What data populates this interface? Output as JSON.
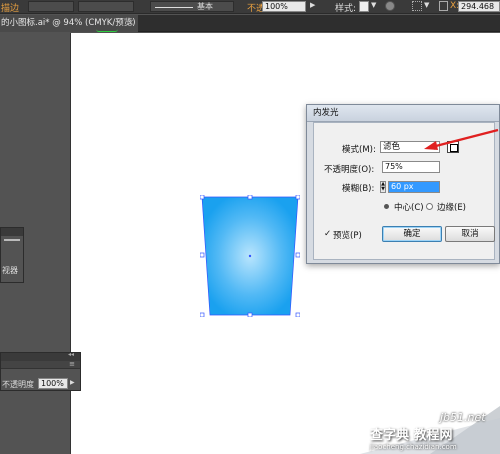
{
  "control_bar": {
    "stroke_label": "描边",
    "stroke_style": "基本",
    "opacity_label": "不透明度",
    "opacity_value": "100%",
    "style_label": "样式:",
    "coord_label": "X:",
    "coord_value": "294.468"
  },
  "document_tab": {
    "title": "的小图标.ai* @ 94% (CMYK/预览)",
    "close": "×"
  },
  "left_panels": {
    "panel_a_text": "视器",
    "panel_b_opacity_label": "不透明度",
    "panel_b_opacity_value": "100%"
  },
  "dialog": {
    "title": "内发光",
    "mode_label": "模式(M):",
    "mode_value": "滤色",
    "opacity_label": "不透明度(O):",
    "opacity_value": "75%",
    "blur_label": "模糊(B):",
    "blur_value": "60 px",
    "center_label": "中心(C)",
    "edge_label": "边缘(E)",
    "preview_label": "预览(P)",
    "ok_label": "确定",
    "cancel_label": "取消"
  },
  "watermark": {
    "site": "jb51.net",
    "brand": "查字典 教程网",
    "url": "jiaocheng.chazidian.com"
  },
  "colors": {
    "shape_center": "#9ed9fb",
    "shape_edge": "#1da1f0",
    "selection": "#3355ff",
    "arrow": "#e02020"
  }
}
